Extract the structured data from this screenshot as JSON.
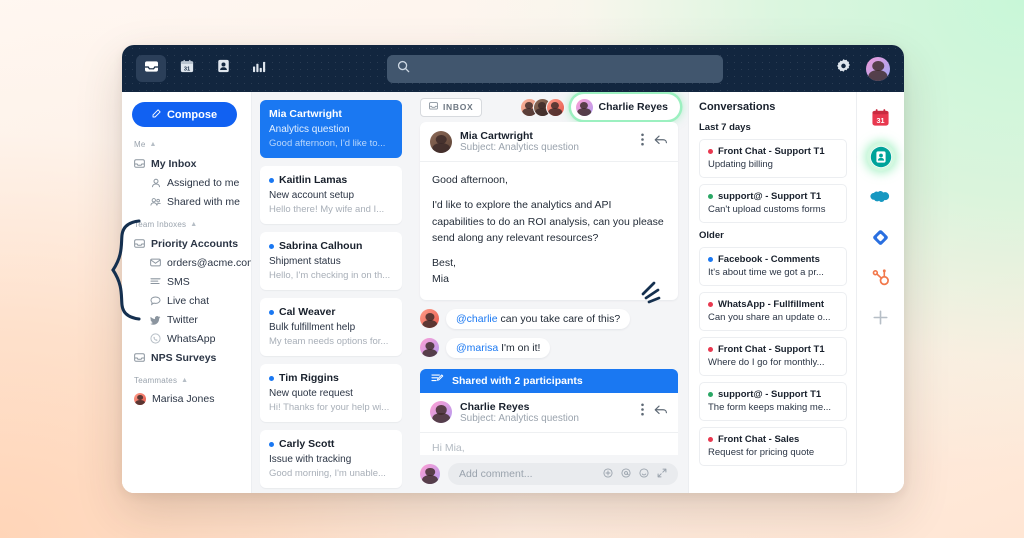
{
  "topbar": {
    "nav": [
      {
        "name": "inbox-icon",
        "label": "Inbox",
        "active": true
      },
      {
        "name": "calendar-icon",
        "label": "Calendar",
        "active": false
      },
      {
        "name": "contacts-icon",
        "label": "Contacts",
        "active": false
      },
      {
        "name": "analytics-icon",
        "label": "Analytics",
        "active": false
      }
    ],
    "calendar_day": "31",
    "search": {
      "value": "",
      "placeholder": ""
    },
    "settings_label": "Settings"
  },
  "sidebar": {
    "compose_label": "Compose",
    "groups": [
      {
        "label": "Me",
        "items": [
          {
            "label": "My Inbox",
            "icon": "inbox-icon",
            "bold": true,
            "indent": false
          },
          {
            "label": "Assigned to me",
            "icon": "person-icon",
            "bold": false,
            "indent": true
          },
          {
            "label": "Shared with me",
            "icon": "people-icon",
            "bold": false,
            "indent": true
          }
        ]
      },
      {
        "label": "Team Inboxes",
        "items": [
          {
            "label": "Priority Accounts",
            "icon": "inbox-icon",
            "bold": true,
            "indent": false
          },
          {
            "label": "orders@acme.com",
            "icon": "envelope-icon",
            "bold": false,
            "indent": true
          },
          {
            "label": "SMS",
            "icon": "sms-icon",
            "bold": false,
            "indent": true
          },
          {
            "label": "Live chat",
            "icon": "chat-icon",
            "bold": false,
            "indent": true
          },
          {
            "label": "Twitter",
            "icon": "twitter-icon",
            "bold": false,
            "indent": true
          },
          {
            "label": "WhatsApp",
            "icon": "whatsapp-icon",
            "bold": false,
            "indent": true
          },
          {
            "label": "NPS Surveys",
            "icon": "inbox-icon",
            "bold": true,
            "indent": false
          }
        ]
      }
    ],
    "teammates_label": "Teammates",
    "teammates": [
      {
        "name": "Marisa Jones"
      }
    ]
  },
  "conversation_list": [
    {
      "name": "Mia Cartwright",
      "subject": "Analytics question",
      "preview": "Good afternoon, I'd like to...",
      "selected": true,
      "unread": false
    },
    {
      "name": "Kaitlin Lamas",
      "subject": "New account setup",
      "preview": "Hello there! My wife and I...",
      "selected": false,
      "unread": true
    },
    {
      "name": "Sabrina Calhoun",
      "subject": "Shipment status",
      "preview": "Hello, I'm checking in on th...",
      "selected": false,
      "unread": true
    },
    {
      "name": "Cal Weaver",
      "subject": "Bulk fulfillment help",
      "preview": "My team needs options for...",
      "selected": false,
      "unread": true
    },
    {
      "name": "Tim Riggins",
      "subject": "New quote request",
      "preview": "Hi! Thanks for your help wi...",
      "selected": false,
      "unread": true
    },
    {
      "name": "Carly Scott",
      "subject": "Issue with tracking",
      "preview": "Good morning, I'm unable...",
      "selected": false,
      "unread": true
    }
  ],
  "message_pane": {
    "inbox_chip": "INBOX",
    "assignee": "Charlie Reyes",
    "participants_count": 3,
    "message": {
      "sender": "Mia Cartwright",
      "subject_label": "Subject: Analytics question",
      "paragraphs": [
        "Good afternoon,",
        "I'd like to explore the analytics and API capabilities to do an ROI analysis, can you please send along any relevant resources?",
        "Best,\nMia"
      ]
    },
    "comments": [
      {
        "mention": "@charlie",
        "text": " can you take care of this?",
        "author": "Marisa Jones"
      },
      {
        "mention": "@marisa",
        "text": " I'm on it!",
        "author": "Charlie Reyes"
      }
    ],
    "shared_bar_label": "Shared with 2 participants",
    "draft": {
      "sender": "Charlie Reyes",
      "subject_label": "Subject: Analytics question",
      "body": "Hi Mia,"
    },
    "comment_input": {
      "value": "",
      "placeholder": "Add comment..."
    },
    "comment_tools": [
      "plus-circle-icon",
      "mention-icon",
      "emoji-icon",
      "expand-icon"
    ]
  },
  "right_panel": {
    "title": "Conversations",
    "groups": [
      {
        "label": "Last 7 days",
        "items": [
          {
            "name": "Front Chat - Support T1",
            "preview": "Updating billing",
            "status_color": "#e8384f"
          },
          {
            "name": "support@ - Support T1",
            "preview": "Can't upload customs forms",
            "status_color": "#2aa765"
          }
        ]
      },
      {
        "label": "Older",
        "items": [
          {
            "name": "Facebook - Comments",
            "preview": "It's about time we got a pr...",
            "status_color": "#1a78f2"
          },
          {
            "name": "WhatsApp - Fullfillment",
            "preview": "Can you share an update o...",
            "status_color": "#e8384f"
          },
          {
            "name": "Front Chat - Support T1",
            "preview": "Where do I go for monthly...",
            "status_color": "#e8384f"
          },
          {
            "name": "support@ - Support T1",
            "preview": "The form keeps making me...",
            "status_color": "#2aa765"
          },
          {
            "name": "Front Chat - Sales",
            "preview": "Request for pricing quote",
            "status_color": "#e8384f"
          }
        ]
      }
    ]
  },
  "rail": {
    "items": [
      {
        "name": "calendar-integration-icon",
        "label": "Calendar",
        "day": "31",
        "color": "#e8384f",
        "active": false
      },
      {
        "name": "contacts-integration-icon",
        "label": "Contacts",
        "color": "#00a39a",
        "active": true
      },
      {
        "name": "salesforce-integration-icon",
        "label": "Salesforce",
        "color": "#1798c1",
        "active": false
      },
      {
        "name": "asana-integration-icon",
        "label": "Asana",
        "color": "#2a6fe0",
        "active": false
      },
      {
        "name": "hubspot-integration-icon",
        "label": "HubSpot",
        "color": "#f2784b",
        "active": false
      },
      {
        "name": "add-integration-icon",
        "label": "Add",
        "color": "#b6bec6",
        "active": false
      }
    ]
  },
  "theme": {
    "accent_blue": "#1a78f2",
    "topbar_navy": "#12263f",
    "highlight_green": "#6ee8a0",
    "panel_gray": "#f4f5f7"
  }
}
